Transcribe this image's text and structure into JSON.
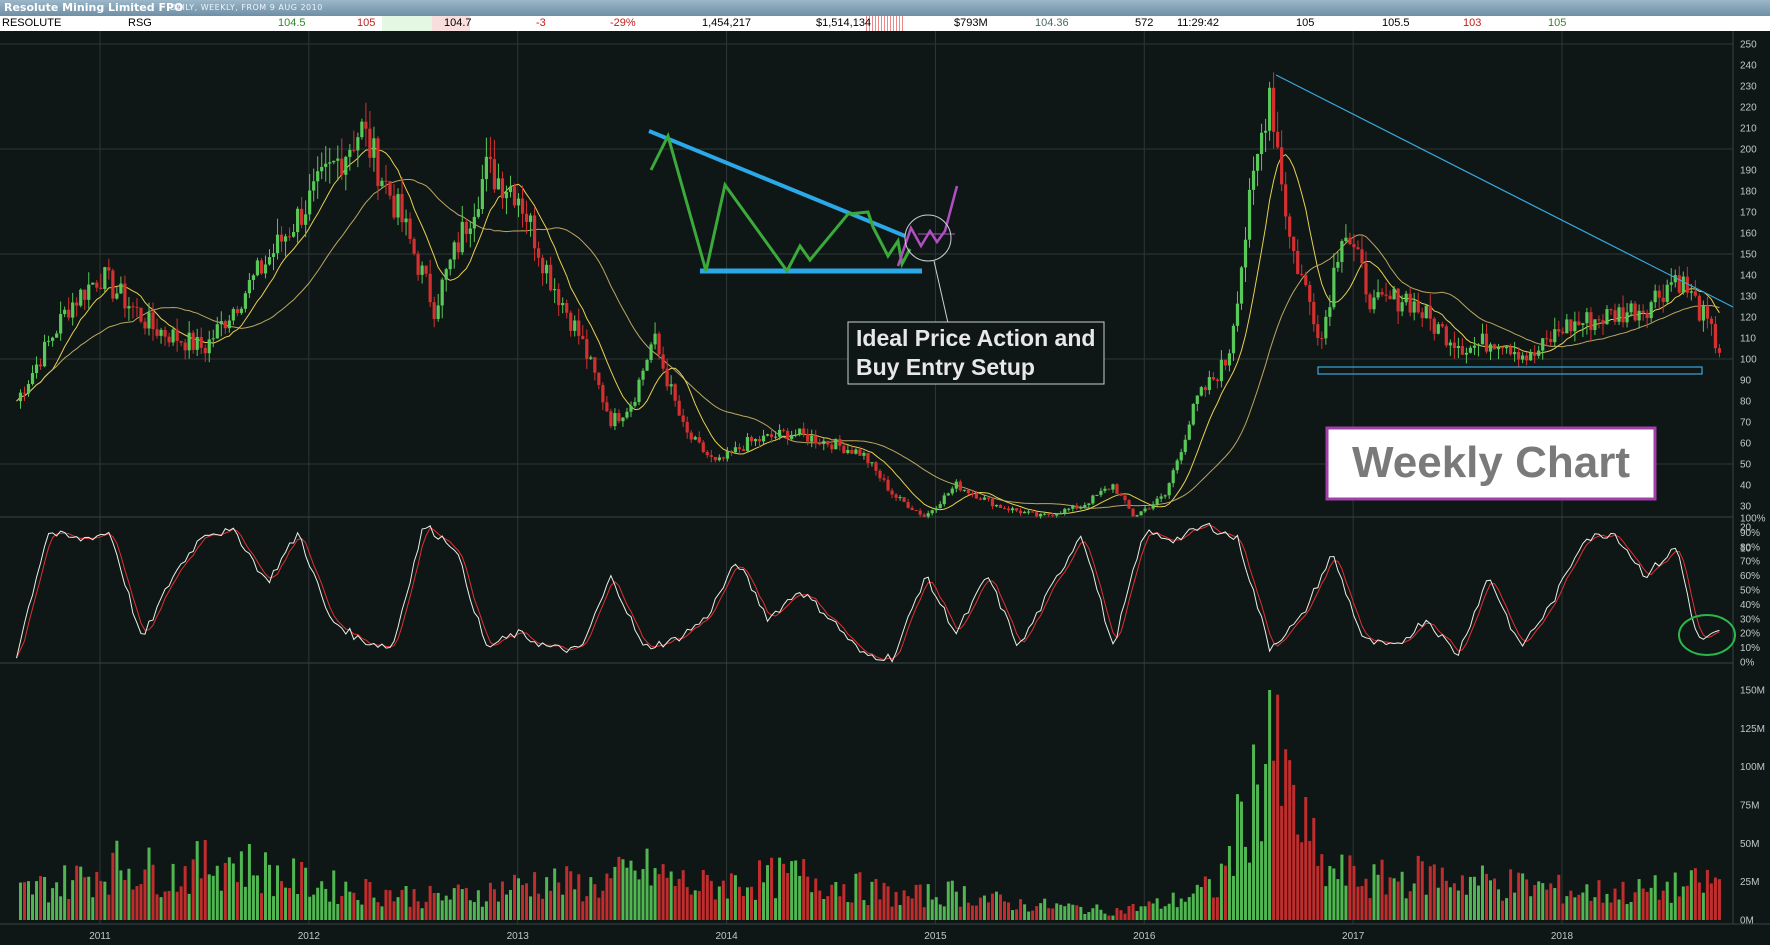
{
  "header": {
    "title": "Resolute Mining Limited FPO",
    "subtitle": "DAILY, WEEKLY, FROM 9 AUG 2010"
  },
  "quote": {
    "symbol": "RESOLUTE",
    "code": "RSG",
    "v1": "104.5",
    "v2": "105",
    "v3": "104.7",
    "change": "-3",
    "change_pct": "-29%",
    "volume": "1,454,217",
    "value": "$1,514,134",
    "market_cap": "$793M",
    "v4": "104.36",
    "trades": "572",
    "time": "11:29:42",
    "v5": "105",
    "v6": "105.5",
    "v7": "103",
    "v8": "105"
  },
  "colors": {
    "background": "#0f1616",
    "up_candle": "#58c858",
    "down_candle": "#d43030",
    "sma_fast": "#e8d050",
    "sma_slow": "#d8c070",
    "stoch_k": "#e8f0e8",
    "stoch_d": "#e03030",
    "trendline": "#3aa8dc",
    "pattern_path": "#3aaa3a",
    "breakout_path": "#b050c0",
    "callout_circle": "#2ab84a",
    "label_border": "#a040a8"
  },
  "annotations": {
    "setup_note": [
      "Ideal Price Action and",
      "Buy Entry Setup"
    ],
    "chart_label": "Weekly Chart"
  },
  "chart_data": [
    {
      "type": "candlestick",
      "title": "Resolute Mining Limited FPO",
      "period": "weekly",
      "x_tick_labels": [
        "2011",
        "2012",
        "2013",
        "2014",
        "2015",
        "2016",
        "2017",
        "2018"
      ],
      "y_tick_labels": [
        "10",
        "20",
        "30",
        "40",
        "50",
        "60",
        "70",
        "80",
        "90",
        "100",
        "110",
        "120",
        "130",
        "140",
        "150",
        "160",
        "170",
        "180",
        "190",
        "200",
        "210",
        "220",
        "230",
        "240",
        "250"
      ],
      "ylim": [
        0,
        255
      ],
      "grid": true,
      "axis_side": "right",
      "overlays": [
        "moving-average-fast",
        "moving-average-slow"
      ],
      "x": [
        2010.6,
        2010.85,
        2011.0,
        2011.25,
        2011.5,
        2011.75,
        2012.0,
        2012.25,
        2012.45,
        2012.6,
        2012.85,
        2013.0,
        2013.15,
        2013.3,
        2013.45,
        2013.55,
        2013.65,
        2013.8,
        2013.95,
        2014.1,
        2014.3,
        2014.5,
        2014.65,
        2014.8,
        2014.95,
        2015.1,
        2015.3,
        2015.5,
        2015.7,
        2015.85,
        2015.95,
        2016.1,
        2016.25,
        2016.4,
        2016.5,
        2016.6,
        2016.7,
        2016.85,
        2016.95,
        2017.1,
        2017.25,
        2017.4,
        2017.55,
        2017.7,
        2017.85,
        2018.0,
        2018.2,
        2018.4,
        2018.55,
        2018.65,
        2018.75
      ],
      "close": [
        80,
        125,
        140,
        115,
        105,
        140,
        175,
        210,
        165,
        125,
        190,
        180,
        140,
        110,
        70,
        80,
        110,
        65,
        50,
        60,
        65,
        60,
        55,
        35,
        25,
        40,
        30,
        25,
        30,
        40,
        25,
        35,
        80,
        100,
        170,
        230,
        155,
        110,
        165,
        125,
        130,
        115,
        105,
        110,
        100,
        115,
        120,
        125,
        140,
        125,
        105
      ]
    },
    {
      "type": "line",
      "title": "",
      "y_tick_labels": [
        "0%",
        "10%",
        "20%",
        "30%",
        "40%",
        "50%",
        "60%",
        "70%",
        "80%",
        "90%",
        "100%"
      ],
      "ylim": [
        0,
        100
      ],
      "series": [
        {
          "x": [
            2010.6,
            2010.75,
            2010.9,
            2011.05,
            2011.2,
            2011.35,
            2011.5,
            2011.65,
            2011.8,
            2011.95,
            2012.1,
            2012.25,
            2012.4,
            2012.55,
            2012.7,
            2012.85,
            2013.0,
            2013.15,
            2013.3,
            2013.45,
            2013.6,
            2013.75,
            2013.9,
            2014.05,
            2014.2,
            2014.35,
            2014.5,
            2014.65,
            2014.8,
            2014.95,
            2015.1,
            2015.25,
            2015.4,
            2015.55,
            2015.7,
            2015.85,
            2016.0,
            2016.15,
            2016.3,
            2016.45,
            2016.6,
            2016.75,
            2016.9,
            2017.05,
            2017.2,
            2017.35,
            2017.5,
            2017.65,
            2017.8,
            2017.95,
            2018.1,
            2018.25,
            2018.4,
            2018.55,
            2018.65,
            2018.75
          ],
          "values": [
            5,
            90,
            85,
            90,
            15,
            60,
            90,
            90,
            55,
            90,
            30,
            15,
            10,
            95,
            80,
            10,
            20,
            10,
            8,
            60,
            10,
            15,
            30,
            70,
            30,
            50,
            30,
            5,
            3,
            60,
            20,
            60,
            10,
            50,
            90,
            10,
            90,
            85,
            95,
            85,
            10,
            30,
            75,
            15,
            10,
            30,
            5,
            60,
            10,
            40,
            85,
            90,
            60,
            80,
            15,
            20
          ]
        }
      ]
    },
    {
      "type": "bar",
      "title": "",
      "y_tick_labels": [
        "0M",
        "25M",
        "50M",
        "75M",
        "100M",
        "125M",
        "150M"
      ],
      "ylim": [
        0,
        155
      ],
      "x": [
        2010.6,
        2010.85,
        2011.1,
        2011.35,
        2011.6,
        2011.85,
        2012.1,
        2012.35,
        2012.6,
        2012.85,
        2013.1,
        2013.35,
        2013.6,
        2013.85,
        2014.1,
        2014.35,
        2014.6,
        2014.85,
        2015.1,
        2015.35,
        2015.6,
        2015.85,
        2016.1,
        2016.35,
        2016.6,
        2016.85,
        2017.1,
        2017.35,
        2017.6,
        2017.85,
        2018.1,
        2018.35,
        2018.6,
        2018.75
      ],
      "values": [
        25,
        35,
        50,
        40,
        55,
        40,
        30,
        25,
        20,
        25,
        35,
        30,
        45,
        30,
        35,
        40,
        30,
        20,
        25,
        15,
        12,
        8,
        15,
        30,
        150,
        45,
        35,
        40,
        35,
        30,
        25,
        25,
        30,
        35
      ]
    }
  ]
}
